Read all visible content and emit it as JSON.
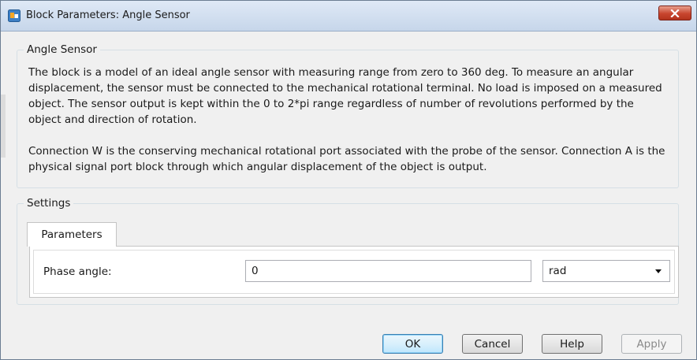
{
  "window": {
    "title": "Block Parameters: Angle Sensor"
  },
  "description_group": {
    "legend": "Angle Sensor",
    "paragraphs": [
      "The block is a model of an ideal angle sensor with measuring range from zero to 360 deg. To measure an angular displacement, the sensor must be connected to the mechanical rotational terminal. No load is imposed on a measured object. The sensor output is kept within the 0 to 2*pi range regardless of number of revolutions performed by the object and direction of rotation.",
      "Connection W is the conserving  mechanical rotational port associated with the probe of the sensor. Connection A is the physical signal port block through which angular displacement of the object is output."
    ]
  },
  "settings_group": {
    "legend": "Settings",
    "tabs": [
      {
        "label": "Parameters",
        "selected": true
      }
    ],
    "fields": [
      {
        "label": "Phase angle:",
        "value": "0",
        "unit": "rad"
      }
    ]
  },
  "buttons": {
    "ok": "OK",
    "cancel": "Cancel",
    "help": "Help",
    "apply": "Apply"
  },
  "icons": {
    "app": "simulink-block-icon",
    "close": "close-icon",
    "dropdown": "chevron-down-icon"
  },
  "colors": {
    "close_button": "#c8452e",
    "default_button_border": "#3c7fb1",
    "window_border": "#6b7d92"
  }
}
